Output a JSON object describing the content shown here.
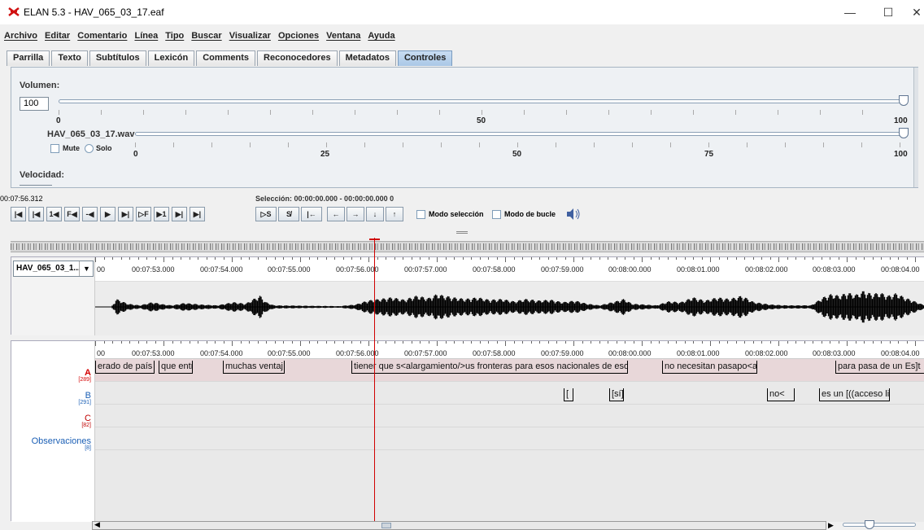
{
  "window": {
    "title": "ELAN 5.3 - HAV_065_03_17.eaf",
    "minimize": "—",
    "maximize": "☐",
    "close": "✕"
  },
  "menu": [
    "Archivo",
    "Editar",
    "Comentario",
    "Línea",
    "Tipo",
    "Buscar",
    "Visualizar",
    "Opciones",
    "Ventana",
    "Ayuda"
  ],
  "tabs": [
    "Parrilla",
    "Texto",
    "Subtítulos",
    "Lexicón",
    "Comments",
    "Reconocedores",
    "Metadatos",
    "Controles"
  ],
  "active_tab": "Controles",
  "controls": {
    "volume_label": "Volumen:",
    "volume_value": "100",
    "volume_level": 100,
    "volume_ticks": [
      "0",
      "50",
      "100"
    ],
    "media_label": "HAV_065_03_17.wav",
    "media_level": 100,
    "media_ticks": [
      "0",
      "25",
      "50",
      "75",
      "100"
    ],
    "mute_label": "Mute",
    "solo_label": "Solo",
    "speed_label": "Velocidad:"
  },
  "transport": {
    "current_time": "00:07:56.312",
    "selection": "Selección: 00:00:00.000 - 00:00:00.000  0",
    "buttons": [
      "|◀",
      "|◀",
      "1◀",
      "F◀",
      "-◀",
      "▶",
      "▶|",
      "▷F",
      "▶1",
      "▶|",
      "▶|"
    ],
    "sel_buttons": [
      "▷S",
      "S̸",
      "|←"
    ],
    "nav_buttons": [
      "←",
      "→",
      "↓",
      "↑"
    ],
    "selection_mode": "Modo selección",
    "loop_mode": "Modo de bucle",
    "volume_icon": "speaker-icon"
  },
  "wave": {
    "track_name": "HAV_065_03_1...",
    "time_labels": [
      "00",
      "00:07:53.000",
      "00:07:54.000",
      "00:07:55.000",
      "00:07:56.000",
      "00:07:57.000",
      "00:07:58.000",
      "00:07:59.000",
      "00:08:00.000",
      "00:08:01.000",
      "00:08:02.000",
      "00:08:03.000",
      "00:08:04.00"
    ]
  },
  "tiers": [
    {
      "name": "A",
      "count": "[289]",
      "color": "#d40000",
      "annotations": [
        "erado de país",
        "que entr",
        "muchas ventaj",
        "tiener que s<alargamiento/>us fronteras para esos nacionales de esos",
        "no necesitan pasapo<alar",
        "para pasa de un Es]t"
      ]
    },
    {
      "name": "B",
      "count": "[291]",
      "color": "#1b5fb5",
      "annotations": [
        "[",
        "[sí]",
        "no<",
        "es un [((acceso li"
      ]
    },
    {
      "name": "C",
      "count": "[82]",
      "color": "#c00000",
      "annotations": []
    },
    {
      "name": "Observaciones",
      "count": "[8]",
      "color": "#1b5fb5",
      "annotations": []
    }
  ]
}
